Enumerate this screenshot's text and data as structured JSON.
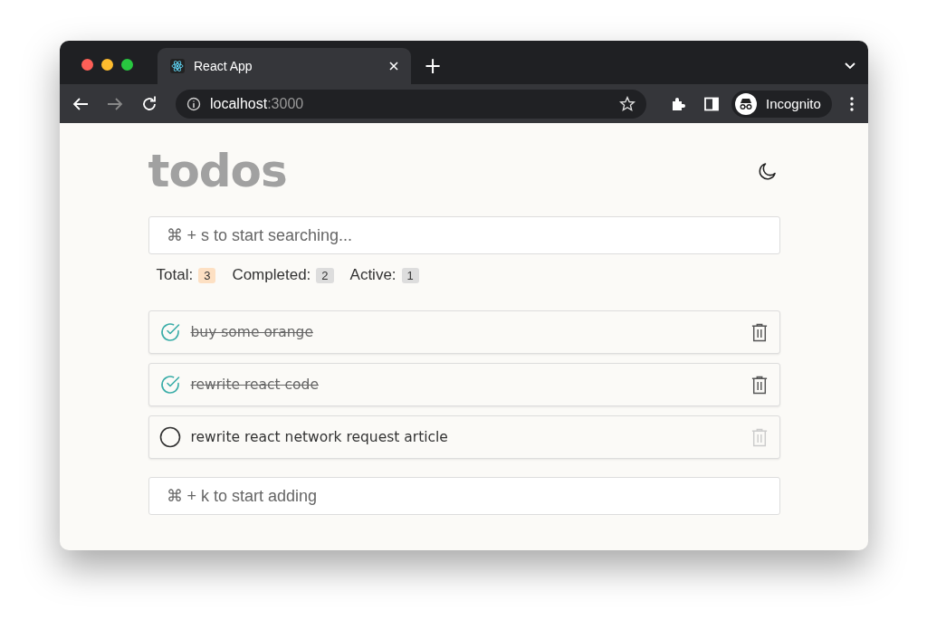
{
  "browser": {
    "tab_title": "React App",
    "new_tab": "+",
    "address_host": "localhost",
    "address_port": ":3000",
    "profile": "Incognito"
  },
  "app": {
    "title": "todos",
    "dark_mode": false
  },
  "search": {
    "placeholder": "⌘ + s to start searching..."
  },
  "stats": [
    {
      "label": "Total:",
      "count": "3",
      "kind": "total"
    },
    {
      "label": "Completed:",
      "count": "2",
      "kind": "completed"
    },
    {
      "label": "Active:",
      "count": "1",
      "kind": "active"
    }
  ],
  "todos": [
    {
      "text": "buy some orange",
      "completed": true
    },
    {
      "text": "rewrite react code",
      "completed": true
    },
    {
      "text": "rewrite react network request article",
      "completed": false
    }
  ],
  "add": {
    "placeholder": "⌘ + k to start adding"
  }
}
